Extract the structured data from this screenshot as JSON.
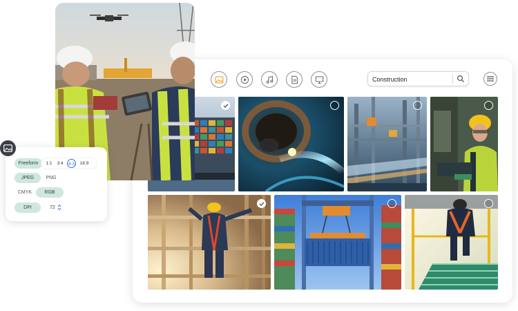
{
  "toolbar": {
    "media_types": [
      "image-type",
      "video-type",
      "audio-type",
      "document-type",
      "presentation-type"
    ],
    "active_type": "image-type"
  },
  "search": {
    "value": "Construction",
    "icon": "search-icon"
  },
  "menu": {
    "icon": "hamburger-menu-icon"
  },
  "gallery": {
    "photos": [
      {
        "subject": "container-ship",
        "selected": true
      },
      {
        "subject": "welder-pipe",
        "selected": false
      },
      {
        "subject": "refinery-pipes",
        "selected": false
      },
      {
        "subject": "woman-factory-worker",
        "selected": false
      },
      {
        "subject": "worker-scaffold",
        "selected": true
      },
      {
        "subject": "container-crane",
        "selected": false
      },
      {
        "subject": "worker-stairs",
        "selected": false
      }
    ]
  },
  "format_panel": {
    "icon": "image-icon",
    "aspect": {
      "freeform_label": "Freeform",
      "ratios": [
        "1:1",
        "3:4",
        "4:3",
        "16:9"
      ],
      "selected_ratio": "4:3"
    },
    "file_types": {
      "jpeg_label": "JPEG",
      "png_label": "PNG",
      "selected": "JPEG"
    },
    "color_modes": {
      "cmyk_label": "CMYK",
      "rgb_label": "RGB",
      "selected": "RGB"
    },
    "dpi": {
      "label": "DPI",
      "value": "72"
    }
  },
  "colors": {
    "accent_active": "#f0a030",
    "pill_selected": "#cfe7df",
    "ratio_selected": "#2c6fd6"
  }
}
